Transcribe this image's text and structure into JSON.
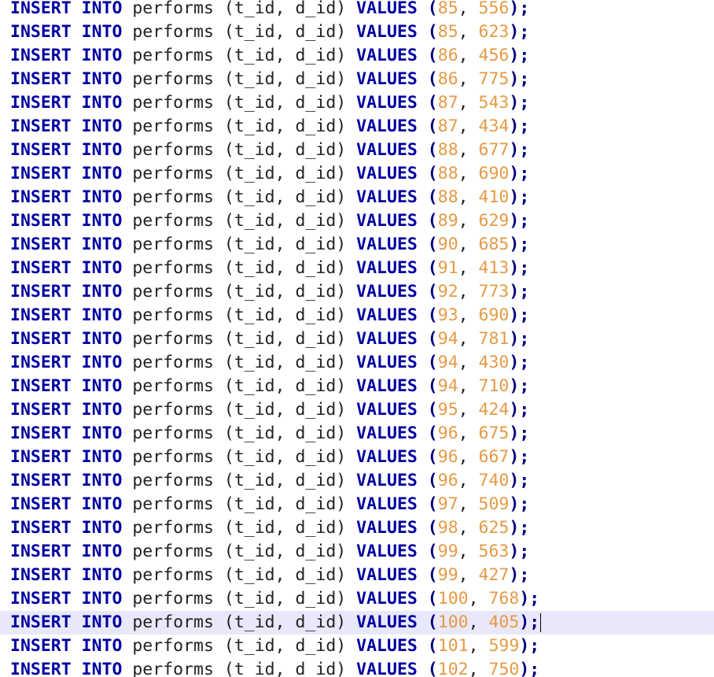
{
  "editor": {
    "keywords": {
      "insert": "INSERT",
      "into": "INTO",
      "values": "VALUES"
    },
    "table": "performs",
    "columns": "(t_id, d_id)",
    "current_line_index": 26,
    "lines": [
      {
        "t_id": "85",
        "d_id": "556"
      },
      {
        "t_id": "85",
        "d_id": "623"
      },
      {
        "t_id": "86",
        "d_id": "456"
      },
      {
        "t_id": "86",
        "d_id": "775"
      },
      {
        "t_id": "87",
        "d_id": "543"
      },
      {
        "t_id": "87",
        "d_id": "434"
      },
      {
        "t_id": "88",
        "d_id": "677"
      },
      {
        "t_id": "88",
        "d_id": "690"
      },
      {
        "t_id": "88",
        "d_id": "410"
      },
      {
        "t_id": "89",
        "d_id": "629"
      },
      {
        "t_id": "90",
        "d_id": "685"
      },
      {
        "t_id": "91",
        "d_id": "413"
      },
      {
        "t_id": "92",
        "d_id": "773"
      },
      {
        "t_id": "93",
        "d_id": "690"
      },
      {
        "t_id": "94",
        "d_id": "781"
      },
      {
        "t_id": "94",
        "d_id": "430"
      },
      {
        "t_id": "94",
        "d_id": "710"
      },
      {
        "t_id": "95",
        "d_id": "424"
      },
      {
        "t_id": "96",
        "d_id": "675"
      },
      {
        "t_id": "96",
        "d_id": "667"
      },
      {
        "t_id": "96",
        "d_id": "740"
      },
      {
        "t_id": "97",
        "d_id": "509"
      },
      {
        "t_id": "98",
        "d_id": "625"
      },
      {
        "t_id": "99",
        "d_id": "563"
      },
      {
        "t_id": "99",
        "d_id": "427"
      },
      {
        "t_id": "100",
        "d_id": "768"
      },
      {
        "t_id": "100",
        "d_id": "405"
      },
      {
        "t_id": "101",
        "d_id": "599"
      },
      {
        "t_id": "102",
        "d_id": "750"
      }
    ]
  },
  "colors": {
    "keyword": "#0000a0",
    "number": "#e59a44",
    "current_line": "#e8e8fa"
  }
}
